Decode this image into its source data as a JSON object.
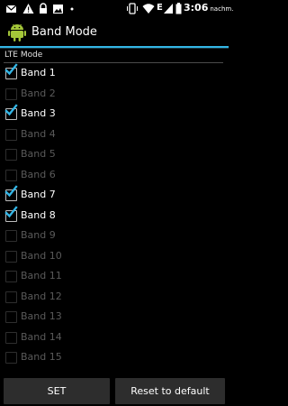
{
  "status_bar": {
    "time": "3:06",
    "time_suffix": "nachm.",
    "icons": [
      "mail-icon",
      "warning-icon",
      "lock-icon",
      "image-icon",
      "dot-icon",
      "vibrate-icon",
      "wifi-icon",
      "signal-icon",
      "battery-icon"
    ],
    "network_label": "E"
  },
  "app_bar": {
    "title": "Band Mode",
    "icon": "android-icon"
  },
  "section": {
    "header": "LTE Mode"
  },
  "bands": [
    {
      "label": "Band 1",
      "checked": true
    },
    {
      "label": "Band 2",
      "checked": false
    },
    {
      "label": "Band 3",
      "checked": true
    },
    {
      "label": "Band 4",
      "checked": false
    },
    {
      "label": "Band 5",
      "checked": false
    },
    {
      "label": "Band 6",
      "checked": false
    },
    {
      "label": "Band 7",
      "checked": true
    },
    {
      "label": "Band 8",
      "checked": true
    },
    {
      "label": "Band 9",
      "checked": false
    },
    {
      "label": "Band 10",
      "checked": false
    },
    {
      "label": "Band 11",
      "checked": false
    },
    {
      "label": "Band 12",
      "checked": false
    },
    {
      "label": "Band 13",
      "checked": false
    },
    {
      "label": "Band 14",
      "checked": false
    },
    {
      "label": "Band 15",
      "checked": false
    }
  ],
  "buttons": {
    "set_label": "SET",
    "reset_label": "Reset to default"
  },
  "colors": {
    "accent": "#33b5e5",
    "background": "#000000",
    "enabled_text": "#ffffff",
    "disabled_text": "#5a5a5a",
    "button_bg": "#2d2d2d"
  }
}
